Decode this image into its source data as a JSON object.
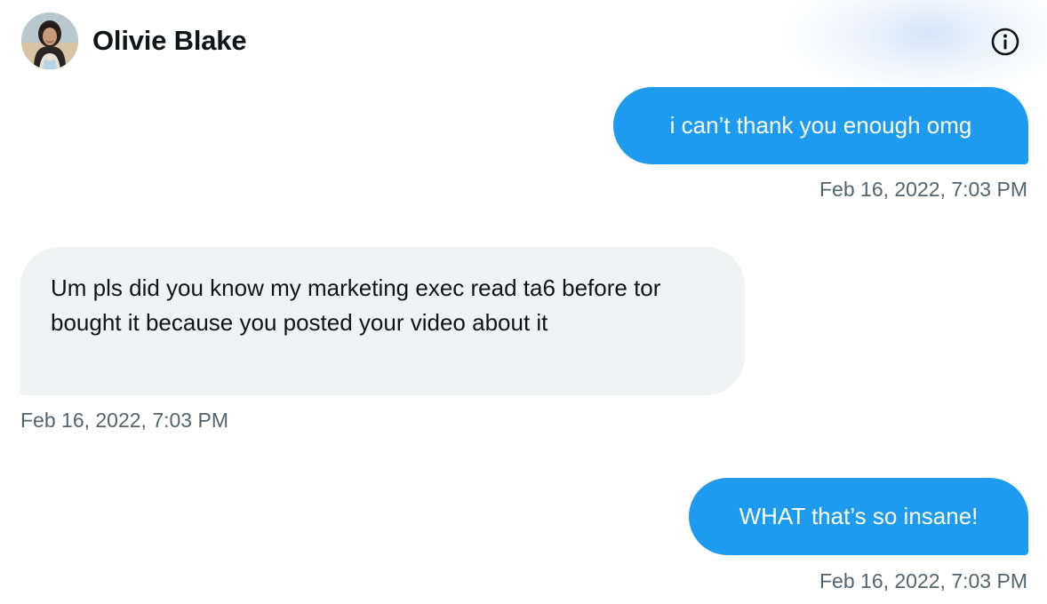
{
  "header": {
    "name": "Olivie Blake",
    "avatar_icon": "avatar-photo",
    "info_icon": "info-circle-icon"
  },
  "messages": [
    {
      "direction": "sent",
      "text": "i can’t thank you enough omg",
      "timestamp": "Feb 16, 2022, 7:03 PM"
    },
    {
      "direction": "received",
      "text": "Um pls did you know my marketing exec read ta6 before tor bought it because you posted your video about it",
      "timestamp": "Feb 16, 2022, 7:03 PM"
    },
    {
      "direction": "sent",
      "text": "WHAT that’s so insane!",
      "timestamp": "Feb 16, 2022, 7:03 PM"
    }
  ],
  "colors": {
    "sent_bubble": "#1d9bf0",
    "received_bubble": "#eff3f4",
    "timestamp_text": "#536471",
    "primary_text": "#0f1419"
  }
}
